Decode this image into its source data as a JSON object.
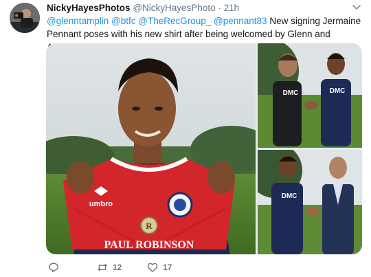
{
  "tweet": {
    "display_name": "NickyHayesPhotos",
    "handle": "@NickyHayesPhoto",
    "separator": "·",
    "timestamp": "21h",
    "text_segments": [
      {
        "text": "@glenntamplin",
        "kind": "mention"
      },
      {
        "text": " ",
        "kind": "plain"
      },
      {
        "text": "@btfc",
        "kind": "mention"
      },
      {
        "text": " ",
        "kind": "plain"
      },
      {
        "text": "@TheRecGroup_",
        "kind": "mention"
      },
      {
        "text": " ",
        "kind": "plain"
      },
      {
        "text": "@pennant83",
        "kind": "mention"
      },
      {
        "text": " New signing Jermaine Pennant poses with his new shirt after being welcomed by Glenn and Andrew,",
        "kind": "plain"
      }
    ]
  },
  "photos": {
    "main": {
      "shirt_brand": "umbro",
      "sponsor": "PAUL ROBINSON",
      "initials": "R"
    },
    "top_right": {
      "shirt_logo": "DMC"
    },
    "bottom_right": {
      "shirt_logo": "DMC"
    }
  },
  "actions": {
    "reply": {
      "icon": "reply-icon",
      "count": ""
    },
    "retweet": {
      "icon": "retweet-icon",
      "count": "12"
    },
    "like": {
      "icon": "heart-icon",
      "count": "17"
    }
  },
  "colors": {
    "link": "#1b95e0",
    "muted": "#657786",
    "text": "#14171a"
  }
}
